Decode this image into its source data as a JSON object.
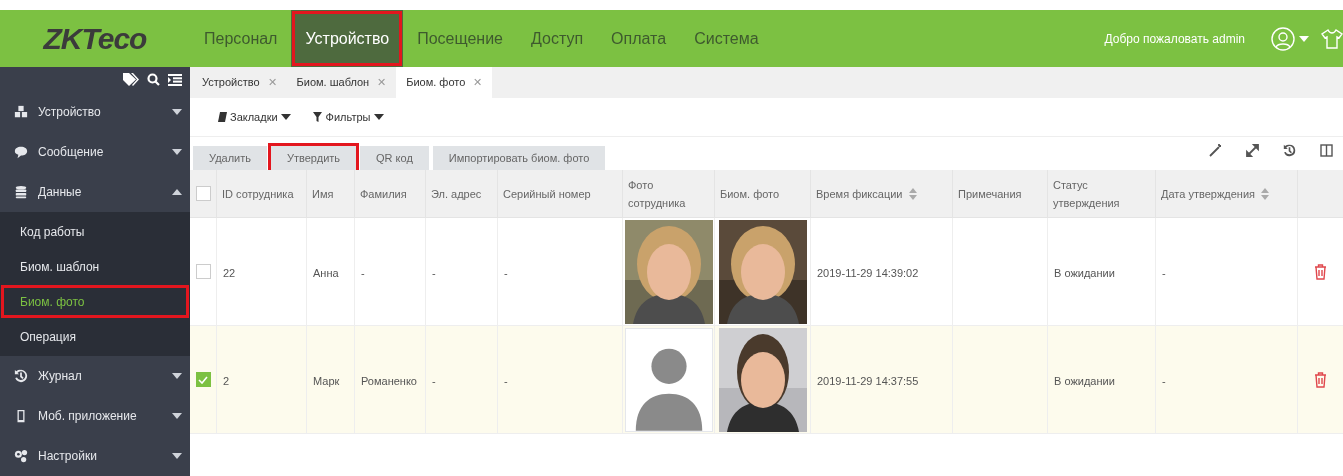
{
  "header": {
    "logo": "ZKTeco",
    "nav": [
      {
        "label": "Персонал",
        "selected": false,
        "highlighted": false
      },
      {
        "label": "Устройство",
        "selected": true,
        "highlighted": true
      },
      {
        "label": "Посещение",
        "selected": false,
        "highlighted": false
      },
      {
        "label": "Доступ",
        "selected": false,
        "highlighted": false
      },
      {
        "label": "Оплата",
        "selected": false,
        "highlighted": false
      },
      {
        "label": "Система",
        "selected": false,
        "highlighted": false
      }
    ],
    "welcome": "Добро пожаловать admin"
  },
  "sidebar": {
    "items": [
      {
        "label": "Устройство",
        "expanded": false
      },
      {
        "label": "Сообщение",
        "expanded": false
      },
      {
        "label": "Данные",
        "expanded": true,
        "children": [
          {
            "label": "Код работы",
            "selected": false,
            "highlighted": false
          },
          {
            "label": "Биом. шаблон",
            "selected": false,
            "highlighted": false
          },
          {
            "label": "Биом. фото",
            "selected": true,
            "highlighted": true
          },
          {
            "label": "Операция",
            "selected": false,
            "highlighted": false
          }
        ]
      },
      {
        "label": "Журнал",
        "expanded": false
      },
      {
        "label": "Моб. приложение",
        "expanded": false
      },
      {
        "label": "Настройки",
        "expanded": false
      }
    ]
  },
  "tabs": [
    {
      "label": "Устройство",
      "selected": false,
      "close": "✕"
    },
    {
      "label": "Биом. шаблон",
      "selected": false,
      "close": "✕"
    },
    {
      "label": "Биом. фото",
      "selected": true,
      "close": "✕"
    }
  ],
  "toolbar": {
    "bookmarks": "Закладки",
    "filters": "Фильтры"
  },
  "actions": [
    {
      "label": "Удалить",
      "highlighted": false
    },
    {
      "label": "Утвердить",
      "highlighted": true
    },
    {
      "label": "QR код",
      "highlighted": false
    },
    {
      "label": "Импортировать биом. фото",
      "highlighted": false
    }
  ],
  "table": {
    "select_all_checked": false,
    "columns": [
      {
        "label": "ID сотрудника",
        "sortable": false
      },
      {
        "label": "Имя",
        "sortable": false
      },
      {
        "label": "Фамилия",
        "sortable": false
      },
      {
        "label": "Эл. адрес",
        "sortable": false
      },
      {
        "label": "Серийный номер",
        "sortable": false
      },
      {
        "label": "Фото сотрудника",
        "sortable": false
      },
      {
        "label": "Биом. фото",
        "sortable": false
      },
      {
        "label": "Время фиксации",
        "sortable": true
      },
      {
        "label": "Примечания",
        "sortable": false
      },
      {
        "label": "Статус утверждения",
        "sortable": false
      },
      {
        "label": "Дата утверждения",
        "sortable": true
      }
    ],
    "rows": [
      {
        "checked": false,
        "id": "22",
        "first_name": "Анна",
        "last_name": "-",
        "email": "-",
        "serial": "-",
        "time": "2019-11-29 14:39:02",
        "status": "В ожидании",
        "approval_date": "-"
      },
      {
        "checked": true,
        "id": "2",
        "first_name": "Марк",
        "last_name": "Романенко",
        "email": "-",
        "serial": "-",
        "employee_photo": {
          "kind": "placeholder"
        },
        "time": "2019-11-29 14:37:55",
        "status": "В ожидании",
        "approval_date": "-"
      }
    ]
  }
}
